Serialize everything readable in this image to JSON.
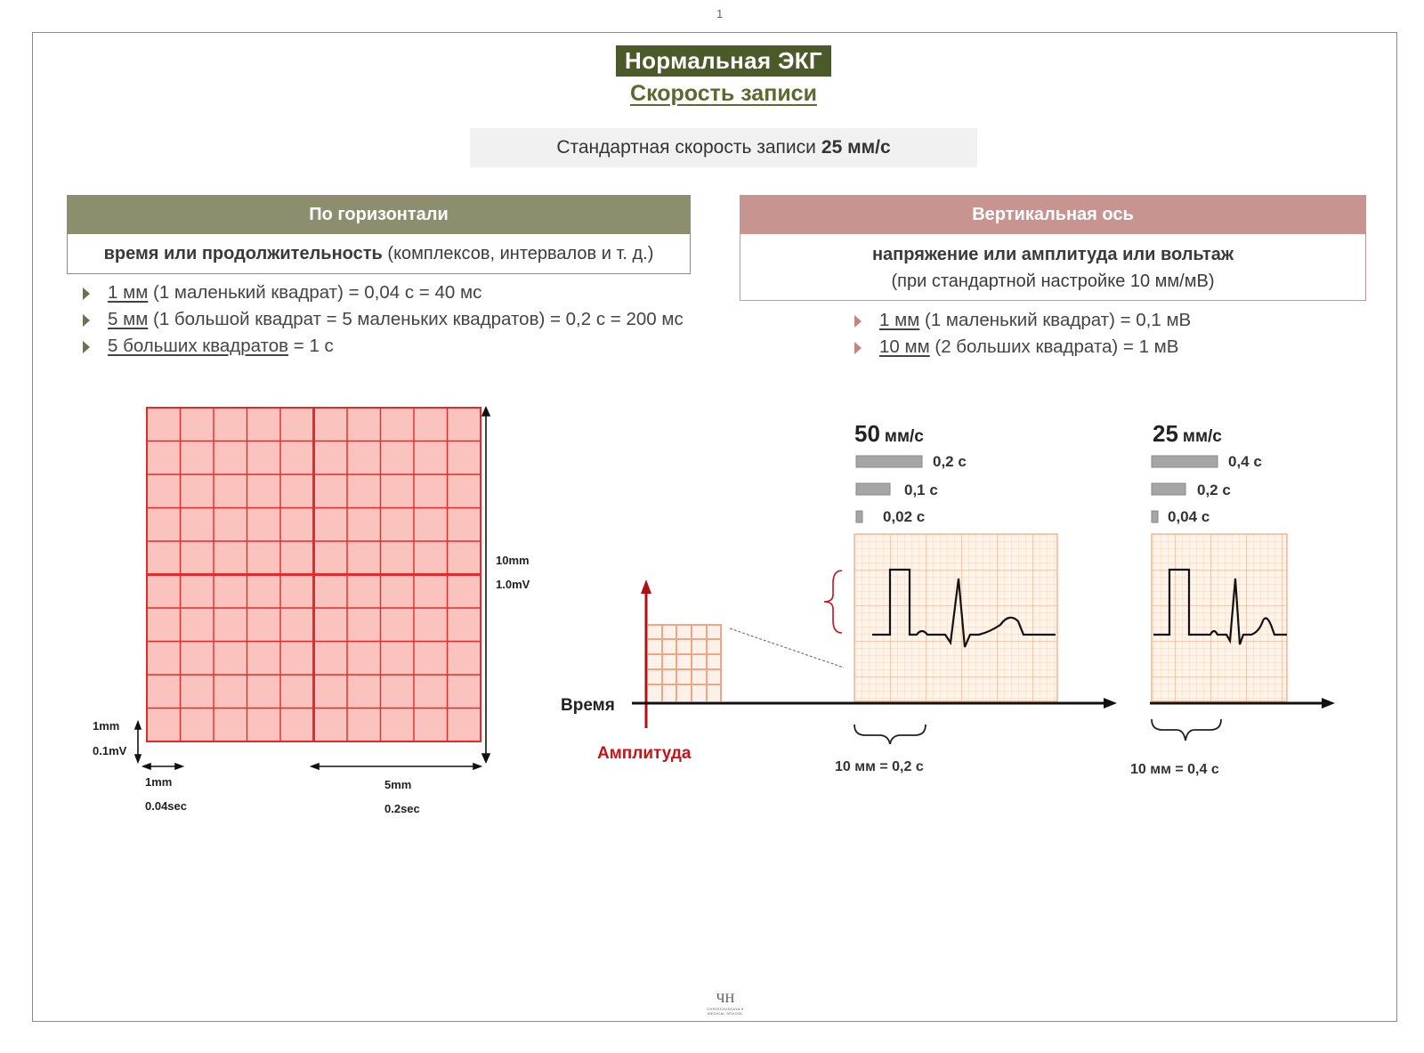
{
  "page": {
    "number": "1"
  },
  "title": "Нормальная ЭКГ",
  "subtitle": "Скорость записи",
  "standard": {
    "text": "Стандартная скорость записи",
    "value": "25 мм/с"
  },
  "horizontal": {
    "header": "По горизонтали",
    "desc_bold": "время или продолжительность",
    "desc_rest": " (комплексов, интервалов и т. д.)",
    "items": [
      {
        "u": "1 мм",
        "rest": " (1 маленький квадрат) = 0,04 с = 40 мс"
      },
      {
        "u": "5 мм",
        "rest": " (1 большой квадрат = 5 маленьких квадратов) = 0,2 с = 200 мс"
      },
      {
        "u": "5 больших квадратов",
        "rest": " = 1 с"
      }
    ]
  },
  "vertical": {
    "header": "Вертикальная ось",
    "desc_bold": "напряжение или амплитуда или вольтаж",
    "desc_rest": "(при стандартной настройке 10 мм/мВ)",
    "items": [
      {
        "u": "1 мм",
        "rest": " (1 маленький квадрат) = 0,1 мВ"
      },
      {
        "u": "10 мм",
        "rest": " (2 больших квадрата) = 1 мВ"
      }
    ]
  },
  "grid": {
    "label_10mm": "10mm",
    "label_1mV": "1.0mV",
    "label_1mm_v": "1mm",
    "label_01mV": "0.1mV",
    "label_1mm_h": "1mm",
    "label_004sec": "0.04sec",
    "label_5mm": "5mm",
    "label_02sec": "0.2sec",
    "colors": {
      "fill": "#fbc3bd",
      "line": "#e32b2b"
    }
  },
  "diagram": {
    "time_label": "Время",
    "amplitude_label": "Амплитуда",
    "amplitude_color": "#c0151a",
    "speed50": {
      "num": "50",
      "unit": "мм/с",
      "bars": [
        "0,2 с",
        "0,1 с",
        "0,02 с"
      ],
      "caption": "10 мм = 0,2 с"
    },
    "speed25": {
      "num": "25",
      "unit": "мм/с",
      "bars": [
        "0,4 с",
        "0,2 с",
        "0,04 с"
      ],
      "caption": "10 мм = 0,4 с"
    }
  },
  "logo": {
    "mark": "ЧН",
    "line1": "CHRISTOVSKAYA'S",
    "line2": "MEDICAL SCHOOL"
  }
}
